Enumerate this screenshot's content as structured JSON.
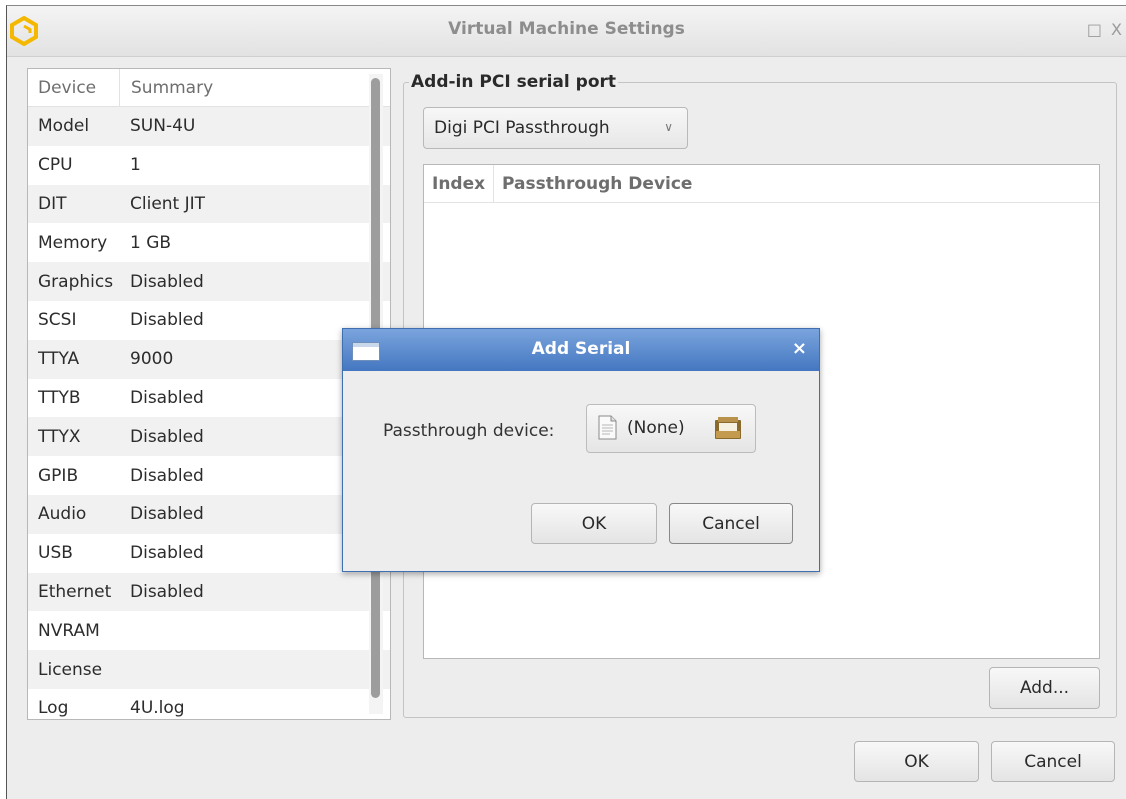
{
  "window": {
    "title": "Virtual Machine Settings",
    "maximize_glyph": "□",
    "close_glyph": "X"
  },
  "device_list": {
    "headers": {
      "device": "Device",
      "summary": "Summary"
    },
    "rows": [
      {
        "device": "Model",
        "summary": "SUN-4U"
      },
      {
        "device": "CPU",
        "summary": "1"
      },
      {
        "device": "DIT",
        "summary": "Client JIT"
      },
      {
        "device": "Memory",
        "summary": "1 GB"
      },
      {
        "device": "Graphics",
        "summary": "Disabled"
      },
      {
        "device": "SCSI",
        "summary": "Disabled"
      },
      {
        "device": "TTYA",
        "summary": "9000"
      },
      {
        "device": "TTYB",
        "summary": "Disabled"
      },
      {
        "device": "TTYX",
        "summary": "Disabled"
      },
      {
        "device": "GPIB",
        "summary": "Disabled"
      },
      {
        "device": "Audio",
        "summary": "Disabled"
      },
      {
        "device": "USB",
        "summary": "Disabled"
      },
      {
        "device": "Ethernet",
        "summary": "Disabled"
      },
      {
        "device": "NVRAM",
        "summary": ""
      },
      {
        "device": "License",
        "summary": ""
      },
      {
        "device": "Log",
        "summary": "4U.log"
      }
    ]
  },
  "panel": {
    "group_title": "Add-in PCI serial port",
    "combo_value": "Digi PCI Passthrough",
    "table_headers": {
      "index": "Index",
      "device": "Passthrough Device"
    },
    "add_button": "Add..."
  },
  "footer": {
    "ok": "OK",
    "cancel": "Cancel"
  },
  "dialog": {
    "title": "Add Serial",
    "close_glyph": "×",
    "label": "Passthrough device:",
    "file_value": "(None)",
    "ok": "OK",
    "cancel": "Cancel"
  },
  "colors": {
    "app_icon": "#f5b800",
    "dialog_titlebar": "#4f80c6"
  },
  "icons": [
    "app-logo-icon",
    "document-icon",
    "folder-icon",
    "dropdown-chevron-icon"
  ]
}
